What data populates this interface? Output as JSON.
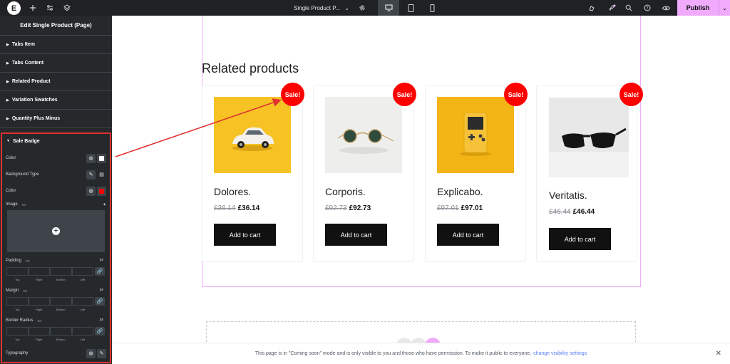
{
  "topbar": {
    "logo": "E",
    "document_name": "Single Product P...",
    "publish_label": "Publish",
    "icons": [
      "elementor-logo-icon",
      "plus-icon",
      "sliders-icon",
      "layers-icon",
      "chevron-down-icon",
      "gear-icon",
      "desktop-icon",
      "tablet-icon",
      "mobile-icon",
      "highlighter-icon",
      "rocket-icon",
      "search-icon",
      "help-icon",
      "eye-icon",
      "chevron-down-icon"
    ]
  },
  "panel": {
    "title": "Edit Single Product (Page)",
    "sections": [
      "Tabs Item",
      "Tabs Content",
      "Related Product",
      "Variation Swatches",
      "Quantity Plus Minus"
    ],
    "sale_badge": {
      "heading": "Sale Badge",
      "color_label": "Color",
      "bg_type_label": "Background Type",
      "bg_color_label": "Color",
      "bg_color": "#ff0000",
      "image_label": "Image",
      "padding_label": "Padding",
      "margin_label": "Margin",
      "border_radius_label": "Border Radius",
      "unit": "px",
      "dim_labels": [
        "Top",
        "Right",
        "Bottom",
        "Left"
      ],
      "typography_label": "Typography"
    }
  },
  "canvas": {
    "heading": "Related products",
    "sale_label": "Sale!",
    "cart_label": "Add to cart",
    "products": [
      {
        "name": "Dolores.",
        "old_price": "£36.14",
        "price": "£36.14",
        "image": "white-car-on-yellow"
      },
      {
        "name": "Corporis.",
        "old_price": "£92.73",
        "price": "£92.73",
        "image": "round-sunglasses"
      },
      {
        "name": "Explicabo.",
        "old_price": "£97.01",
        "price": "£97.01",
        "image": "handheld-console-on-yellow"
      },
      {
        "name": "Veritatis.",
        "old_price": "£46.44",
        "price": "£46.44",
        "image": "black-sunglasses"
      }
    ],
    "notice_text": "This page is in \"Coming soon\" mode and is only visible to you and those who have permission. To make it public to everyone,",
    "notice_link": "change visibility settings"
  },
  "colors": {
    "accent": "#f0abfc",
    "sale": "#ff0000",
    "highlight": "#e03131"
  }
}
